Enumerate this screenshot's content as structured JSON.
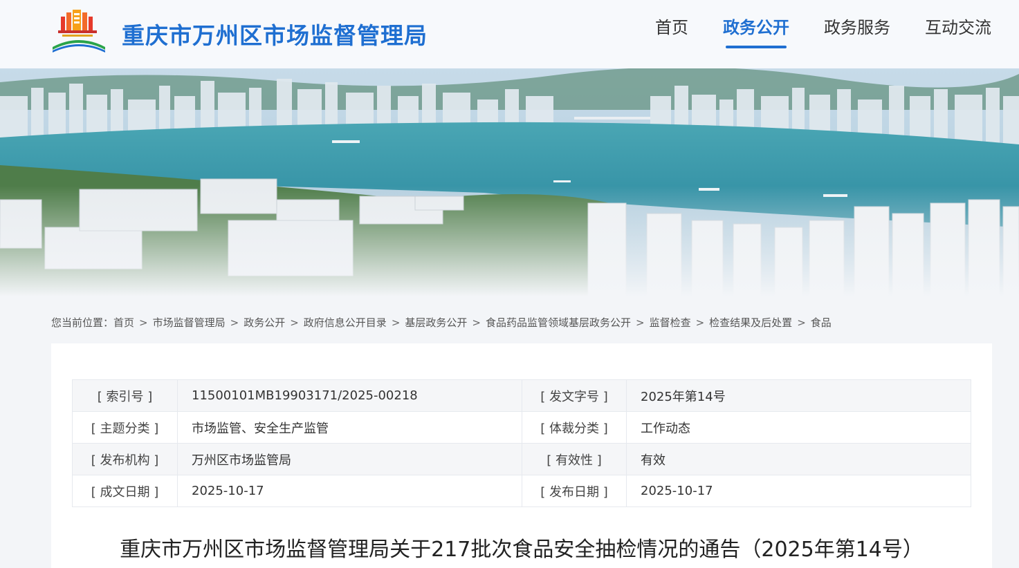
{
  "header": {
    "site_title": "重庆市万州区市场监督管理局",
    "logo_icon": "municipal-building-emblem-icon",
    "nav": [
      {
        "label": "首页",
        "active": false
      },
      {
        "label": "政务公开",
        "active": true
      },
      {
        "label": "政务服务",
        "active": false
      },
      {
        "label": "互动交流",
        "active": false
      }
    ]
  },
  "breadcrumb": {
    "prefix": "您当前位置：",
    "items": [
      "首页",
      "市场监督管理局",
      "政务公开",
      "政府信息公开目录",
      "基层政务公开",
      "食品药品监管领域基层政务公开",
      "监督检查",
      "检查结果及后处置",
      "食品"
    ],
    "separator": ">"
  },
  "meta": {
    "index_no_label": "[ 索引号 ]",
    "index_no": "11500101MB19903171/2025-00218",
    "doc_no_label": "[ 发文字号 ]",
    "doc_no": "2025年第14号",
    "topic_label": "[ 主题分类 ]",
    "topic": "市场监管、安全生产监管",
    "genre_label": "[ 体裁分类 ]",
    "genre": "工作动态",
    "publisher_label": "[ 发布机构 ]",
    "publisher": "万州区市场监管局",
    "validity_label": "[ 有效性 ]",
    "validity": "有效",
    "created_label": "[ 成文日期 ]",
    "created": "2025-10-17",
    "published_label": "[ 发布日期 ]",
    "published": "2025-10-17"
  },
  "document": {
    "title": "重庆市万州区市场监督管理局关于217批次食品安全抽检情况的通告（2025年第14号）"
  },
  "colors": {
    "brand_blue": "#1f6fd1",
    "text": "#333333",
    "page_bg": "#f3f5f8"
  }
}
